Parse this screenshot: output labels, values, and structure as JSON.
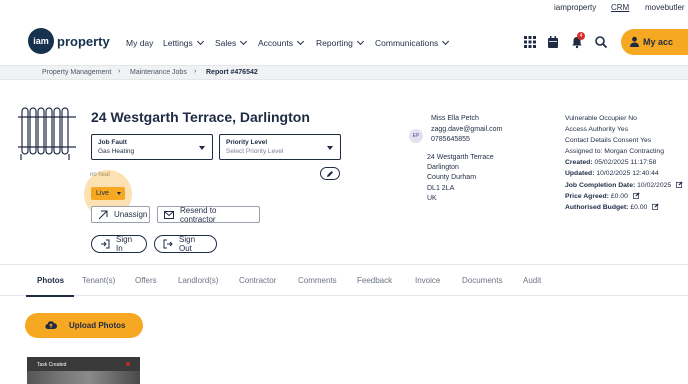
{
  "top_links": {
    "iamproperty": "iamproperty",
    "crm": "CRM",
    "movebutler": "movebutler"
  },
  "logo": {
    "mark": "iam",
    "word": "property"
  },
  "nav": {
    "items": [
      {
        "label": "My day",
        "dropdown": false
      },
      {
        "label": "Lettings",
        "dropdown": true
      },
      {
        "label": "Sales",
        "dropdown": true
      },
      {
        "label": "Accounts",
        "dropdown": true
      },
      {
        "label": "Reporting",
        "dropdown": true
      },
      {
        "label": "Communications",
        "dropdown": true
      }
    ],
    "icons": [
      "grid-icon",
      "calendar-icon",
      "bell-icon",
      "search-icon"
    ],
    "notification_count": "4",
    "account_label": "My acc"
  },
  "breadcrumb": {
    "items": [
      "Property Management",
      "Maintenance Jobs",
      "Report #476542"
    ]
  },
  "job": {
    "title": "24 Westgarth Terrace, Darlington",
    "job_fault_label": "Job Fault",
    "job_fault_value": "Gas Heating",
    "priority_label": "Priority Level",
    "priority_placeholder": "Select Priority Level",
    "subtitle": "no heat",
    "status": "Live",
    "unassign_label": "Unassign",
    "resend_label": "Resend to contractor",
    "sign_in_label": "Sign In",
    "sign_out_label": "Sign Out"
  },
  "contact": {
    "initials": "EP",
    "name": "Miss Ella Petch",
    "email": "zagg.dave@gmail.com",
    "phone": "0785645855",
    "address": [
      "24 Westgarth Terrace",
      "Darlington",
      "County Durham",
      "DL1 2LA",
      "UK"
    ]
  },
  "details": [
    {
      "label": "Vulnerable Occupier",
      "value": "No",
      "bold": false,
      "edit": false
    },
    {
      "label": "Access Authority",
      "value": "Yes",
      "bold": false,
      "edit": false
    },
    {
      "label": "Contact Details Consent",
      "value": "Yes",
      "bold": false,
      "edit": false
    },
    {
      "label": "Assigned to:",
      "value": "Morgan Contracting",
      "bold": false,
      "edit": false
    },
    {
      "label": "Created:",
      "value": "05/02/2025 11:17:58",
      "bold": true,
      "edit": false
    },
    {
      "label": "Updated:",
      "value": "10/02/2025 12:40:44",
      "bold": true,
      "edit": false
    },
    {
      "label": "Job Completion Date:",
      "value": "10/02/2025",
      "bold": true,
      "edit": true
    },
    {
      "label": "Price Agreed:",
      "value": "£0.00",
      "bold": true,
      "edit": true
    },
    {
      "label": "Authorised Budget:",
      "value": "£0.00",
      "bold": true,
      "edit": true
    }
  ],
  "tabs": [
    "Photos",
    "Tenant(s)",
    "Offers",
    "Landlord(s)",
    "Contractor",
    "Comments",
    "Feedback",
    "Invoice",
    "Documents",
    "Audit"
  ],
  "active_tab": "Photos",
  "upload_label": "Upload Photos",
  "thumbnail": {
    "caption": "Task Created"
  },
  "colors": {
    "accent": "#f7a823",
    "navy": "#16324f",
    "text": "#1f2a44"
  }
}
